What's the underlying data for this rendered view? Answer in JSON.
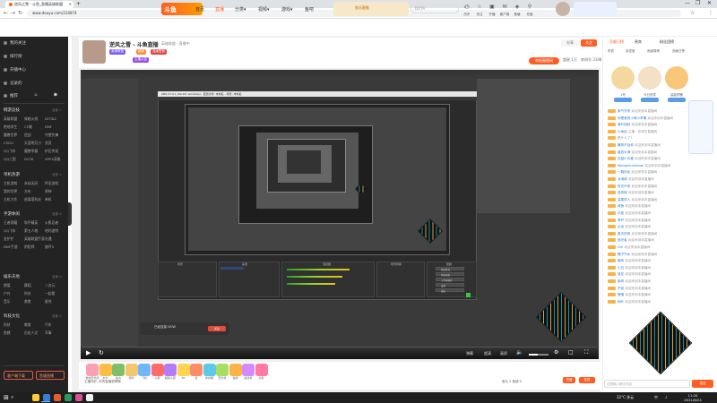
{
  "browser": {
    "tab_title": "逆风之雪 - 斗鱼_直播英雄联盟",
    "tab_close": "×",
    "new_tab": "+",
    "url": "www.douyu.com/314874",
    "win_controls": [
      "—",
      "❐",
      "✕"
    ]
  },
  "site_header": {
    "logo_text": "斗鱼",
    "menu": [
      "首页",
      "直播",
      "分类▾",
      "视频▾",
      "游戏▾",
      "鱼吧",
      "鱼乐星推"
    ],
    "active_menu": "直播",
    "banner_text": "鱼乐星推",
    "search_placeholder": "DOTA",
    "icons": [
      {
        "glyph": "◷",
        "label": "历史"
      },
      {
        "glyph": "☆",
        "label": "关注"
      },
      {
        "glyph": "▣",
        "label": "开播"
      },
      {
        "glyph": "✉",
        "label": "客户端"
      },
      {
        "glyph": "◈",
        "label": "鱼塘"
      },
      {
        "glyph": "⚲",
        "label": "充值"
      }
    ]
  },
  "sidebar": {
    "top_items": [
      "我的关注",
      "排行榜",
      "开播中心",
      "记录的"
    ],
    "row_icons": [
      "推荐",
      "⚔",
      "⬢"
    ],
    "sections": [
      {
        "title": "网游竞技",
        "more": "全部 >",
        "items": [
          "英雄联盟",
          "穿越火线",
          "DOTA2",
          "绝地求生",
          "CF端",
          "DNF",
          "魔兽世界",
          "逆战",
          "守望先锋",
          "CSGO",
          "天涯明月刀",
          "剑灵",
          "QQ飞车",
          "魔兽争霸",
          "炉石传说",
          "QQ三国",
          "DOTA",
          "APEX英雄"
        ]
      },
      {
        "title": "单机热游",
        "more": "全部 >",
        "items": [
          "主机游戏",
          "永劫无间",
          "怀旧游戏",
          "我的世界",
          "方舟",
          "原神",
          "主机大作",
          "逃离塔科夫",
          "单机"
        ]
      },
      {
        "title": "手游休闲",
        "more": "全部 >",
        "items": [
          "王者荣耀",
          "和平精英",
          "火影忍者",
          "QQ飞车",
          "第五人格",
          "哈利波特",
          "金铲铲",
          "英雄联盟手游",
          "光遇",
          "DNF手游",
          "阴阳师",
          "崩坏3",
          "明日方舟",
          "梦幻手游"
        ]
      },
      {
        "title": "娱乐天地",
        "more": "全部 >",
        "items": [
          "颜值",
          "舞蹈",
          "二次元",
          "户外",
          "科技",
          "一起看",
          "音乐",
          "美食",
          "星秀"
        ]
      },
      {
        "title": "科技文化",
        "more": "全部 >",
        "items": [
          "科技",
          "教育",
          "汽车",
          "鱼教",
          "历史人文",
          "军事"
        ]
      }
    ],
    "bottom_buttons": [
      "客户端下载",
      "鱼塘直播"
    ]
  },
  "room": {
    "title": "逆风之雪 - 斗鱼直播",
    "meta_line": "直播 · 英雄联盟 · 直播中",
    "tags": [
      "英雄联盟",
      "超管",
      "连续签到",
      "主播认证"
    ],
    "share": "分享",
    "follow": "关注",
    "report": "举报直播间",
    "right_meta": [
      "超星 1万",
      "房间号 314874"
    ]
  },
  "player": {
    "window_title": "OBS 27.0.1 (64-bit, windows) - 配置文件: 未命名 - 场景: 未命名",
    "controls": [
      "▶",
      "↻",
      "⚙",
      "□",
      "⛶"
    ],
    "time_label": "直播中",
    "right_controls": [
      "弹幕",
      "超清",
      "画质"
    ],
    "volume": 0.45
  },
  "obs": {
    "docks": [
      "场景",
      "来源",
      "混音器",
      "场景转换",
      "控制"
    ],
    "control_buttons": [
      "开始推流",
      "开始录制",
      "工作室模式",
      "设置",
      "退出"
    ]
  },
  "stream_card": {
    "text": "已经连接 NOW",
    "button": "关注"
  },
  "gifts": [
    {
      "label": "粉丝荧光棒",
      "color": "#ff9fb2"
    },
    {
      "label": "办卡",
      "color": "#ffbc42"
    },
    {
      "label": "鱼丸",
      "color": "#7fbf6a"
    },
    {
      "label": "弱鸡",
      "color": "#f5c66b"
    },
    {
      "label": "飞机",
      "color": "#6fb6ff"
    },
    {
      "label": "火箭",
      "color": "#ff6b6b"
    },
    {
      "label": "超级火箭",
      "color": "#b47bff"
    },
    {
      "label": "66",
      "color": "#ffd34d"
    },
    {
      "label": "赞",
      "color": "#ff8c69"
    },
    {
      "label": "棒棒糖",
      "color": "#5ec8e8"
    },
    {
      "label": "荧光棒",
      "color": "#a7de63"
    },
    {
      "label": "鱼翅",
      "color": "#ffb347"
    },
    {
      "label": "魔法棒",
      "color": "#d28cff"
    },
    {
      "label": "点赞",
      "color": "#ff7aa2"
    }
  ],
  "gift_input": {
    "placeholder": "主播你好, 你的直播很棒哦",
    "balance": "鱼丸 0  鱼翅 0",
    "send": "充值",
    "send2": "发送"
  },
  "chat": {
    "tabs": [
      "贡献日榜",
      "贵宾",
      "粉丝团榜"
    ],
    "active_tab": "贡献日榜",
    "rank_tabs": [
      "贵宾",
      "亲密度",
      "贡献周榜",
      "贡献日榜"
    ],
    "top_ranks": [
      {
        "name": "1号",
        "color": "#f5d7a0"
      },
      {
        "name": "今日贵宾",
        "color": "#f3e0c5"
      },
      {
        "name": "高能预警",
        "color": "#f7c77a"
      }
    ],
    "messages": [
      {
        "user": "紫气东来",
        "text": "欢迎来到本直播间"
      },
      {
        "user": "你是我的小呀小苹果",
        "text": "欢迎来到本直播间"
      },
      {
        "user": "落叶知秋",
        "text": "欢迎来到本直播间"
      },
      {
        "user": "小幸运",
        "text": "主播 : 你现在直播的"
      },
      {
        "user": "",
        "text": "是什么了?"
      },
      {
        "user": "暖风不及你",
        "text": "欢迎来到本直播间"
      },
      {
        "user": "星辰大海",
        "text": "欢迎来到本直播间"
      },
      {
        "user": "无敌小可爱",
        "text": "欢迎来到本直播间"
      },
      {
        "user": "Wangshuaishuai",
        "text": "欢迎来到本直播间"
      },
      {
        "user": "一路向北",
        "text": "欢迎来到本直播间"
      },
      {
        "user": "冰淇淋",
        "text": "欢迎来到本直播间"
      },
      {
        "user": "时光不老",
        "text": "欢迎来到本直播间"
      },
      {
        "user": "若风轻",
        "text": "欢迎来到本直播间"
      },
      {
        "user": "温柔的人",
        "text": "欢迎来到本直播间"
      },
      {
        "user": "咸鱼",
        "text": "欢迎来到本直播间"
      },
      {
        "user": "半夏",
        "text": "欢迎来到本直播间"
      },
      {
        "user": "青柠",
        "text": "欢迎来到本直播间"
      },
      {
        "user": "云朵",
        "text": "欢迎来到本直播间"
      },
      {
        "user": "夏天的风",
        "text": "欢迎来到本直播间"
      },
      {
        "user": "追光者",
        "text": "欢迎来到本直播间"
      },
      {
        "user": "Ctrl",
        "text": "欢迎来到本直播间"
      },
      {
        "user": "橘子汽水",
        "text": "欢迎来到本直播间"
      },
      {
        "user": "晚风",
        "text": "欢迎来到本直播间"
      },
      {
        "user": "小丑",
        "text": "欢迎来到本直播间"
      },
      {
        "user": "浪花",
        "text": "欢迎来到本直播间"
      },
      {
        "user": "南风",
        "text": "欢迎来到本直播间"
      },
      {
        "user": "不如",
        "text": "欢迎来到本直播间"
      },
      {
        "user": "慢慢",
        "text": "欢迎来到本直播间"
      },
      {
        "user": "树叶",
        "text": "欢迎来到本直播间"
      }
    ],
    "input_placeholder": "这里输入聊天内容",
    "send": "发送"
  },
  "taskbar": {
    "start": "⊞",
    "search": "⌕",
    "apps": [
      "#ffcc33",
      "#3a7bd5",
      "#e25c2f",
      "#2b9a5a",
      "#d94f9a",
      "#f0f0f0"
    ],
    "tray": [
      "32°C 多云",
      "中",
      "♪"
    ],
    "time": "11:20",
    "date": "2021/8/24"
  },
  "colors": {
    "accent": "#ff5d23",
    "sidebar_bg": "#232323",
    "chat_user": "#2b7bd3"
  }
}
